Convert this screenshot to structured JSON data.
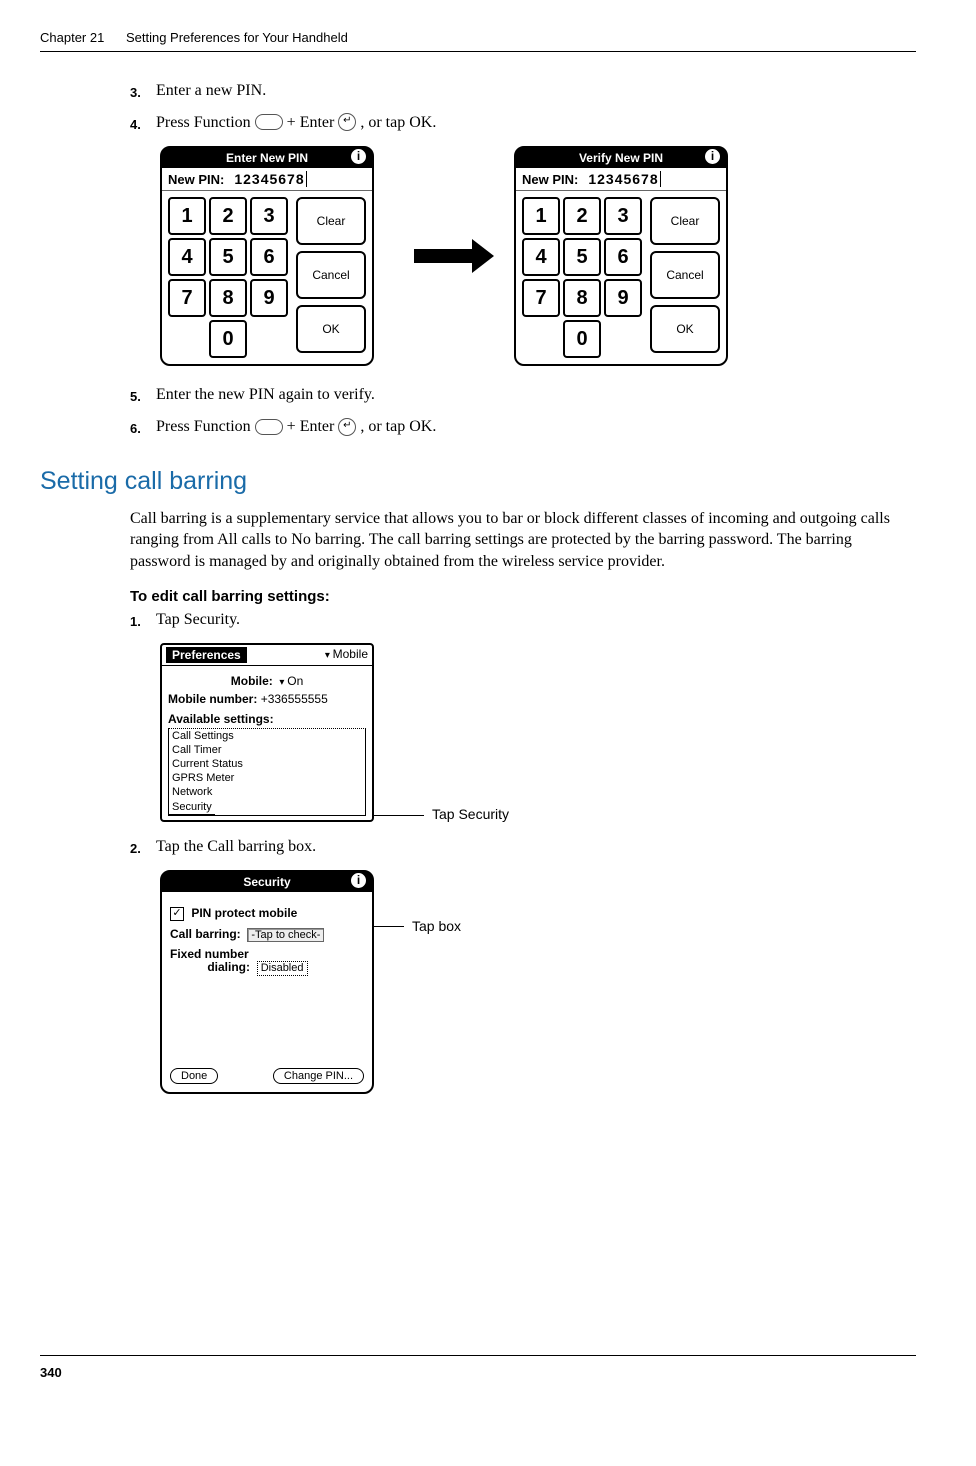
{
  "header": {
    "chapter": "Chapter 21",
    "title": "Setting Preferences for Your Handheld"
  },
  "steps_top": {
    "s3": {
      "num": "3.",
      "text": "Enter a new PIN."
    },
    "s4": {
      "num": "4.",
      "text_a": "Press Function ",
      "text_b": " + Enter ",
      "text_c": ", or tap OK."
    },
    "s5": {
      "num": "5.",
      "text": "Enter the new PIN again to verify."
    },
    "s6": {
      "num": "6.",
      "text_a": "Press Function ",
      "text_b": " + Enter ",
      "text_c": ", or tap OK."
    }
  },
  "pin_screens": {
    "left_title": "Enter New PIN",
    "right_title": "Verify New PIN",
    "label": "New PIN:",
    "value": "12345678",
    "keys": [
      "1",
      "2",
      "3",
      "4",
      "5",
      "6",
      "7",
      "8",
      "9",
      "0"
    ],
    "btn_clear": "Clear",
    "btn_cancel": "Cancel",
    "btn_ok": "OK"
  },
  "section_heading": "Setting call barring",
  "section_body": "Call barring is a supplementary service that allows you to bar or block different classes of incoming and outgoing calls ranging from All calls to No barring. The call barring settings are protected by the barring password. The barring password is managed by and originally obtained from the wireless service provider.",
  "subhead": "To edit call barring settings:",
  "steps_bottom": {
    "s1": {
      "num": "1.",
      "text": "Tap Security."
    },
    "s2": {
      "num": "2.",
      "text": "Tap the Call barring box."
    }
  },
  "pref_screen": {
    "title_left": "Preferences",
    "title_right": "Mobile",
    "mobile_label": "Mobile:",
    "mobile_value": "On",
    "number_label": "Mobile number:",
    "number_value": "+336555555",
    "available_label": "Available settings:",
    "items": [
      "Call Settings",
      "Call Timer",
      "Current Status",
      "GPRS Meter",
      "Network",
      "Security"
    ]
  },
  "callouts": {
    "tap_security": "Tap Security",
    "tap_box": "Tap box"
  },
  "sec_screen": {
    "title": "Security",
    "pin_protect": "PIN protect mobile",
    "call_barring_label": "Call barring:",
    "call_barring_value": "-Tap to check-",
    "fixed_label_a": "Fixed number",
    "fixed_label_b": "dialing:",
    "fixed_value": "Disabled",
    "done": "Done",
    "change_pin": "Change PIN..."
  },
  "page_number": "340"
}
